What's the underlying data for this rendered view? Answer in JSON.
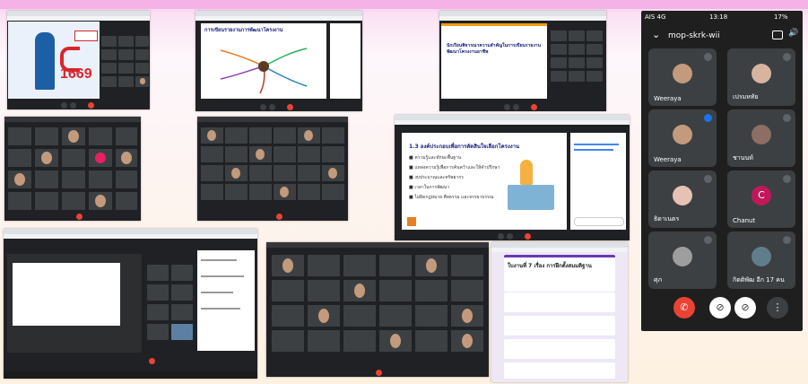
{
  "shot1": {
    "banner_number": "1669"
  },
  "shot2": {
    "slide_title": "การเขียนรายงานการพัฒนาโครงงาน"
  },
  "shot3": {
    "slide_title": "นักเรียนพิจารณาความสำคัญในการเขียนรายงาน พัฒนาโครงงานอาชีพ"
  },
  "shot6": {
    "slide_title": "1.3 องค์ประกอบเพื่อการตัดสินใจเลือกโครงงาน",
    "bullets": [
      "ความรู้และทักษะพื้นฐาน",
      "แหล่งความรู้เพื่อการค้นคว้าและให้คำปรึกษา",
      "งบประมาณและทรัพยากร",
      "เวลาในการพัฒนา",
      "ไม่ผิดกฎหมาย ศีลธรรม และจรรยาบรรณ"
    ]
  },
  "shot9": {
    "form_title": "ใบงานที่ 7 เรื่อง การฝึกตั้งสมมติฐาน"
  },
  "phone": {
    "carrier": "AIS 4G",
    "time": "13:18",
    "battery": "17%",
    "meeting_code": "mop-skrk-wii",
    "participants": [
      {
        "name": "Weeraya"
      },
      {
        "name": "เปรมหทัย"
      },
      {
        "name": "Weeraya"
      },
      {
        "name": "ชานนท์"
      },
      {
        "name": "ธิดาเนตร"
      },
      {
        "name": "Chanut",
        "initial": "C"
      },
      {
        "name": "ศุภ"
      },
      {
        "name": "กิตติพัฒ อีก 17 คน"
      }
    ]
  },
  "colors": {
    "hangup": "#ea4335",
    "banner_red": "#d9262b",
    "chanut_avatar": "#c2185b"
  }
}
